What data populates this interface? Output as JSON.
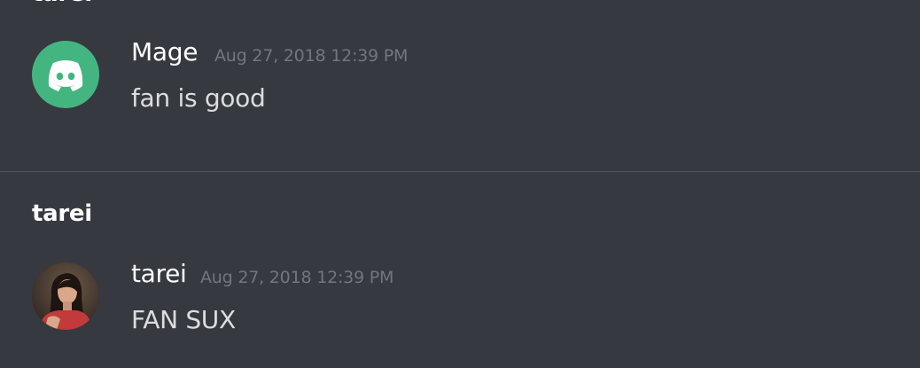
{
  "top_partial_header": "tarei",
  "messages": [
    {
      "username": "Mage",
      "timestamp": "Aug 27, 2018 12:39 PM",
      "content": "fan is good",
      "avatar_icon": "discord-logo-icon",
      "avatar_color": "#43b581"
    },
    {
      "username": "tarei",
      "timestamp": "Aug 27, 2018 12:39 PM",
      "content": "FAN SUX",
      "avatar_icon": "user-photo"
    }
  ],
  "section_header": "tarei",
  "colors": {
    "background": "#36393f",
    "username": "#ffffff",
    "timestamp": "#72767d",
    "text": "#dcddde",
    "divider": "#4f545c",
    "brand": "#43b581"
  }
}
